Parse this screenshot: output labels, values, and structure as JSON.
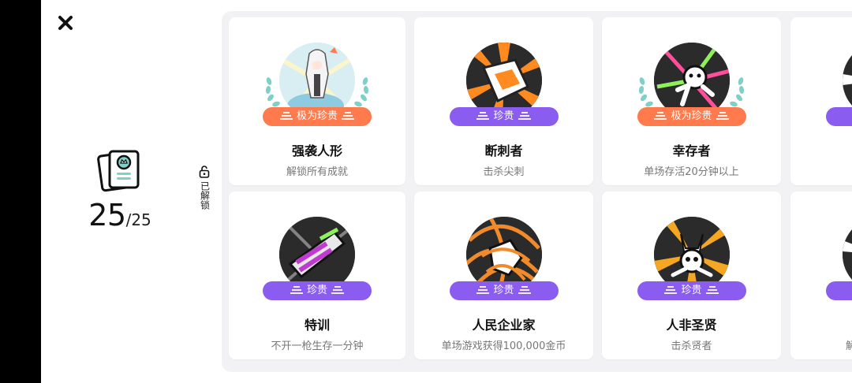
{
  "summary": {
    "unlocked": "25",
    "total": "/25"
  },
  "filter": {
    "label": "已解锁"
  },
  "colors": {
    "legendary": "#ff7a4d",
    "rare": "#8a5cf0",
    "laurel": "#7fd1c8"
  },
  "cards": [
    {
      "rarity": "极为珍贵",
      "rarity_type": "legendary",
      "title": "强袭人形",
      "desc": "解锁所有成就",
      "icon": "robot-girl-medal-icon"
    },
    {
      "rarity": "珍贵",
      "rarity_type": "rare",
      "title": "断刺者",
      "desc": "击杀尖刺",
      "icon": "broken-spike-medal-icon"
    },
    {
      "rarity": "极为珍贵",
      "rarity_type": "legendary",
      "title": "幸存者",
      "desc": "单场存活20分钟以上",
      "icon": "survivor-medal-icon"
    },
    {
      "rarity": "",
      "rarity_type": "rare",
      "title": "",
      "desc": "",
      "icon": "partial-medal-icon"
    },
    {
      "rarity": "珍贵",
      "rarity_type": "rare",
      "title": "特训",
      "desc": "不开一枪生存一分钟",
      "icon": "training-medal-icon"
    },
    {
      "rarity": "珍贵",
      "rarity_type": "rare",
      "title": "人民企业家",
      "desc": "单场游戏获得100,000金币",
      "icon": "entrepreneur-medal-icon"
    },
    {
      "rarity": "珍贵",
      "rarity_type": "rare",
      "title": "人非圣贤",
      "desc": "击杀贤者",
      "icon": "sage-slayer-medal-icon"
    },
    {
      "rarity": "",
      "rarity_type": "rare",
      "title": "",
      "desc": "解",
      "icon": "partial-medal-icon"
    }
  ]
}
